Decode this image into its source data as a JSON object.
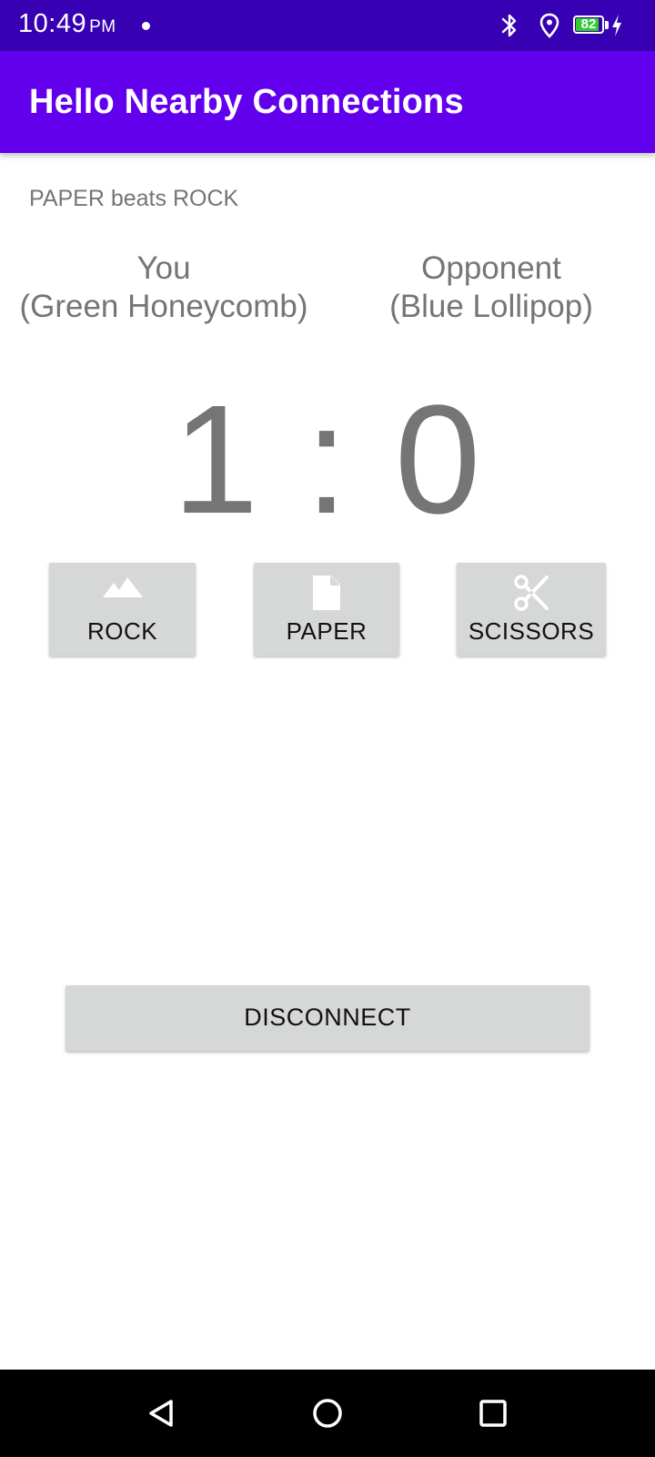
{
  "status_bar": {
    "time": "10:49",
    "ampm": "PM",
    "battery_level": "82",
    "battery_color": "#2ecc2e",
    "icons": [
      "dot-icon",
      "bluetooth-icon",
      "location-icon",
      "battery-icon",
      "charging-icon"
    ]
  },
  "app_bar": {
    "title": "Hello Nearby Connections",
    "color": "#6200ee"
  },
  "game": {
    "last_result": "PAPER beats ROCK",
    "you_label": "You",
    "you_name": "(Green Honeycomb)",
    "opponent_label": "Opponent",
    "opponent_name": "(Blue Lollipop)",
    "score": "1 : 0"
  },
  "choices": [
    {
      "label": "ROCK",
      "icon": "landscape-icon"
    },
    {
      "label": "PAPER",
      "icon": "document-icon"
    },
    {
      "label": "SCISSORS",
      "icon": "scissors-icon"
    }
  ],
  "actions": {
    "disconnect_label": "DISCONNECT"
  },
  "nav_bar": {
    "icons": [
      "back-icon",
      "home-icon",
      "recents-icon"
    ]
  }
}
